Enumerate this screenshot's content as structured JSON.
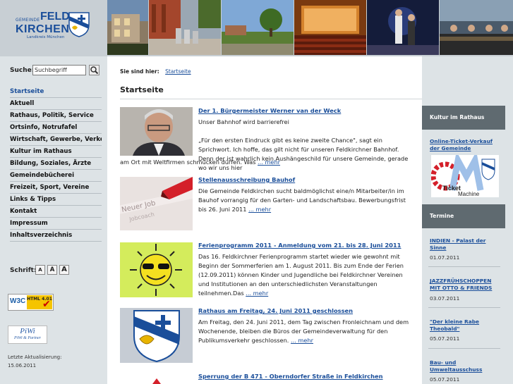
{
  "logo": {
    "gemeinde": "GEMEINDE",
    "feld": "FELD",
    "kirchen": "KIRCHEN",
    "landkreis": "Landkreis München"
  },
  "sidebar": {
    "search_label": "Suche:",
    "search_value": "Suchbegriff",
    "nav": [
      "Startseite",
      "Aktuell",
      "Rathaus, Politik, Service",
      "Ortsinfo, Notrufafel",
      "Wirtschaft, Gewerbe, Verkehr",
      "Kultur im Rathaus",
      "Bildung, Soziales, Ärzte",
      "Gemeindebücherei",
      "Freizeit, Sport, Vereine",
      "Links & Tipps",
      "Kontakt",
      "Impressum",
      "Inhaltsverzeichnis"
    ],
    "font_label": "Schrift:",
    "font_sizes": [
      "A",
      "A",
      "A"
    ],
    "w3c": "W3C",
    "html_badge": "HTML 4.01",
    "piwi": "PiWi",
    "piwi_sub": "PiWi & Partner",
    "last_update_label": "Letzte Aktualisierung:",
    "last_update_date": "15.06.2011"
  },
  "main": {
    "breadcrumb_label": "Sie sind hier:",
    "breadcrumb_link": "Startseite",
    "page_title": "Startseite",
    "news": [
      {
        "title": "Der 1. Bürgermeister Werner van der Weck",
        "text": "Unser Bahnhof wird barrierefrei",
        "text2": "„Für den ersten Eindruck gibt es keine zweite Chance\", sagt ein Sprichwort. Ich hoffe, das gilt nicht für unseren Feldkirchner Bahnhof. Denn der ist wahrlich kein Aushängeschild für unsere Gemeinde, gerade wo wir uns hier",
        "wrap": "am Ort mit Weltfirmen schmücken dürfen. Was",
        "more": "... mehr"
      },
      {
        "title": "Stellenausschreibung Bauhof",
        "text": "Die Gemeinde Feldkirchen sucht baldmöglichst eine/n Mitarbeiter/in im Bauhof vorrangig für den Garten- und Landschaftsbau. Bewerbungsfrist bis 26. Juni 2011",
        "more": "... mehr"
      },
      {
        "title": "Ferienprogramm 2011 - Anmeldung vom 21. bis 28. Juni 2011",
        "text": "Das 16. Feldkirchner Ferienprogramm startet wieder wie gewohnt mit Beginn der Sommerferien am 1. August 2011. Bis zum Ende der Ferien (12.09.2011) können Kinder und Jugendliche bei Feldkirchner Vereinen und Institutionen an den unterschiedlichsten Veranstaltungen teilnehmen.Das",
        "more": "... mehr"
      },
      {
        "title": "Rathaus am Freitag, 24. Juni 2011 geschlossen",
        "text": "Am Freitag, den 24. Juni 2011, dem Tag zwischen Fronleichnam und dem Wochenende, bleiben die Büros der Gemeindeverwaltung für den Publikumsverkehr geschlossen.",
        "more": "... mehr"
      },
      {
        "title": "Sperrung der B 471 - Oberndorfer Straße in Feldkirchen"
      }
    ]
  },
  "right": {
    "kultur_heading": "Kultur im Rathaus",
    "ticket_link": "Online-Ticket-Verkauf der Gemeinde",
    "ticket_logo_text": "Ticket Machine",
    "termine_heading": "Termine",
    "events": [
      {
        "title": "INDIEN - Palast der Sinne",
        "date": "01.07.2011"
      },
      {
        "title": "JAZZFRÜHSCHOPPEN MIT OTTO & FRIENDS",
        "date": "03.07.2011"
      },
      {
        "title": "\"Der kleine Rabe Theobald\"",
        "date": "05.07.2011"
      },
      {
        "title": "Bau- und Umweltausschuss",
        "date": "05.07.2011"
      }
    ]
  },
  "colors": {
    "brand_blue": "#1a4e9a",
    "sidebar_bg": "#dde3e6",
    "right_heading_bg": "#5f6a70"
  }
}
